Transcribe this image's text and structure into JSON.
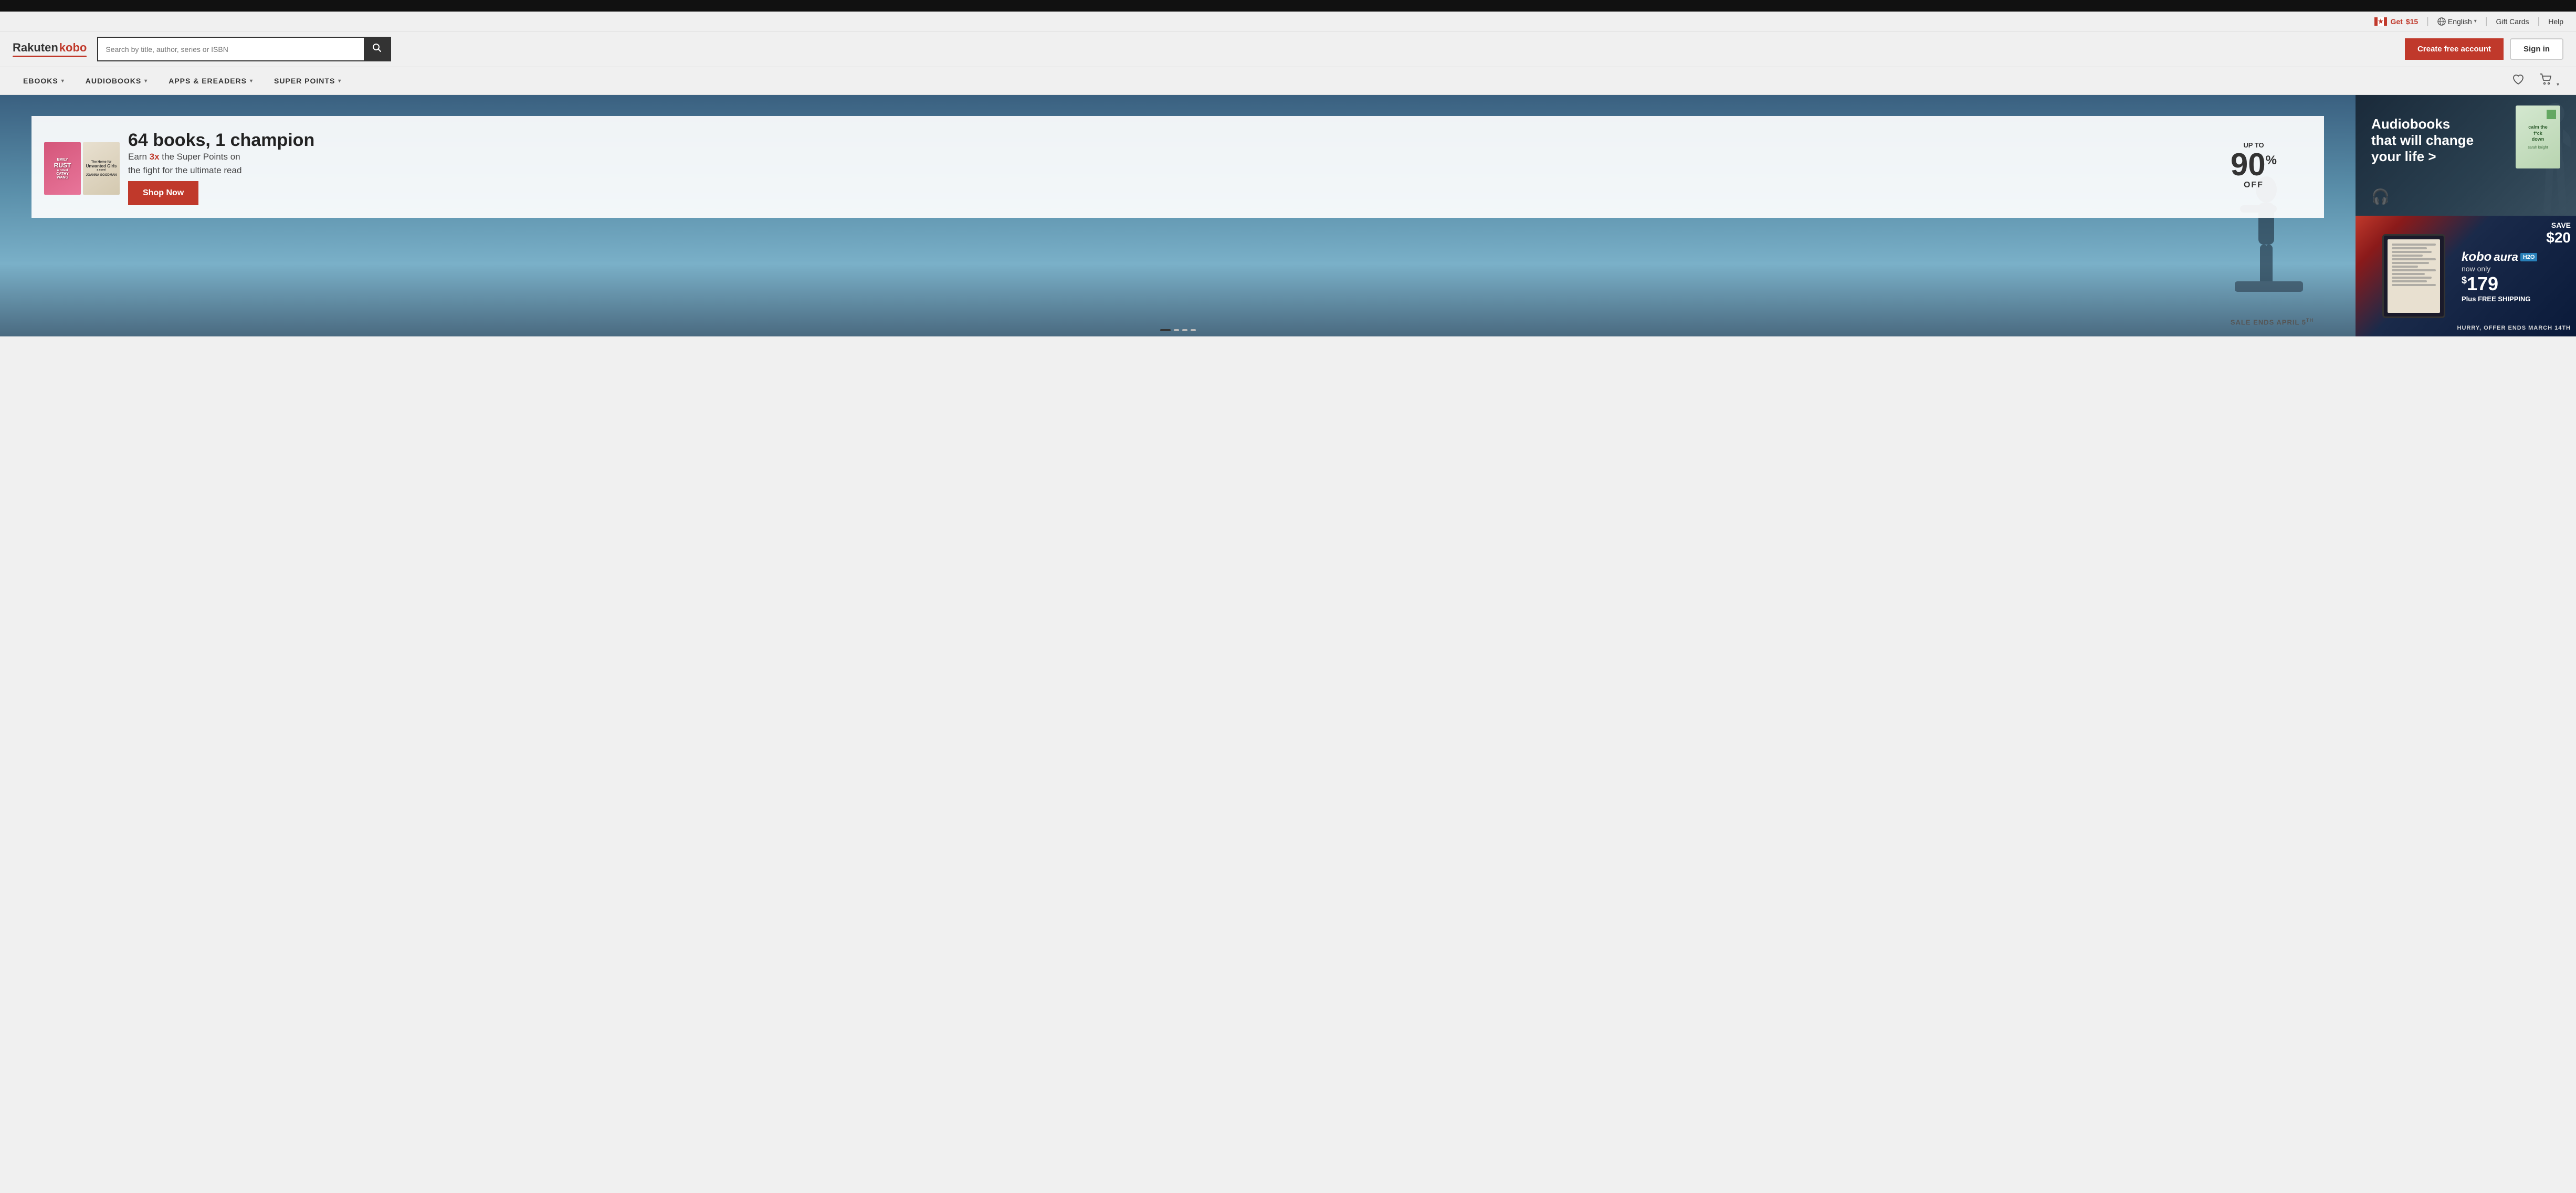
{
  "black_bar": "",
  "utility_bar": {
    "promo_get": "Get",
    "promo_amount": "$15",
    "lang_label": "English",
    "gift_cards": "Gift Cards",
    "help": "Help"
  },
  "header": {
    "logo_rakuten": "Rakuten",
    "logo_kobo": "kobo",
    "search_placeholder": "Search by title, author, series or ISBN",
    "create_account": "Create free account",
    "sign_in": "Sign in"
  },
  "nav": {
    "ebooks": "eBOOKS",
    "audiobooks": "AUDIOBOOKS",
    "apps_ereaders": "APPS & eREADERS",
    "super_points": "SUPER POINTS"
  },
  "hero": {
    "discount_up_to": "UP TO",
    "discount_pct": "90",
    "discount_sup": "%",
    "discount_off": "OFF",
    "title": "64 books, 1 champion",
    "subtitle_prefix": "Earn ",
    "subtitle_highlight": "3x",
    "subtitle_suffix": " the Super Points on",
    "subtitle_line2": "the fight for the ultimate read",
    "shop_now": "Shop Now",
    "sale_ends": "SALE ENDS APRIL 5",
    "sale_ends_sup": "TH",
    "book1_line1": "EMILY",
    "book1_line2": "RUST",
    "book1_line3": "a novel",
    "book1_line4": "CATHY",
    "book1_line5": "WANG",
    "book2_line1": "The Home for",
    "book2_line2": "Unwanted Girls",
    "book2_line3": "a novel",
    "book2_line4": "JOANNA GOODMAN"
  },
  "promo_audiobooks": {
    "title_line1": "Audiobooks",
    "title_line2": "that will change",
    "title_line3": "your life >",
    "book_title": "calm the\nf*ck\ndown"
  },
  "promo_ereader": {
    "save_label": "SAVE",
    "save_amount": "$20",
    "brand": "kobo",
    "model": "aura",
    "h2o": "H2O",
    "now_only": "now only",
    "price_symbol": "$",
    "price": "179",
    "free_shipping": "Plus FREE SHIPPING",
    "hurry": "HURRY, OFFER ENDS MARCH 14TH"
  },
  "dots": [
    {
      "active": true
    },
    {
      "active": false
    },
    {
      "active": false
    },
    {
      "active": false
    }
  ]
}
